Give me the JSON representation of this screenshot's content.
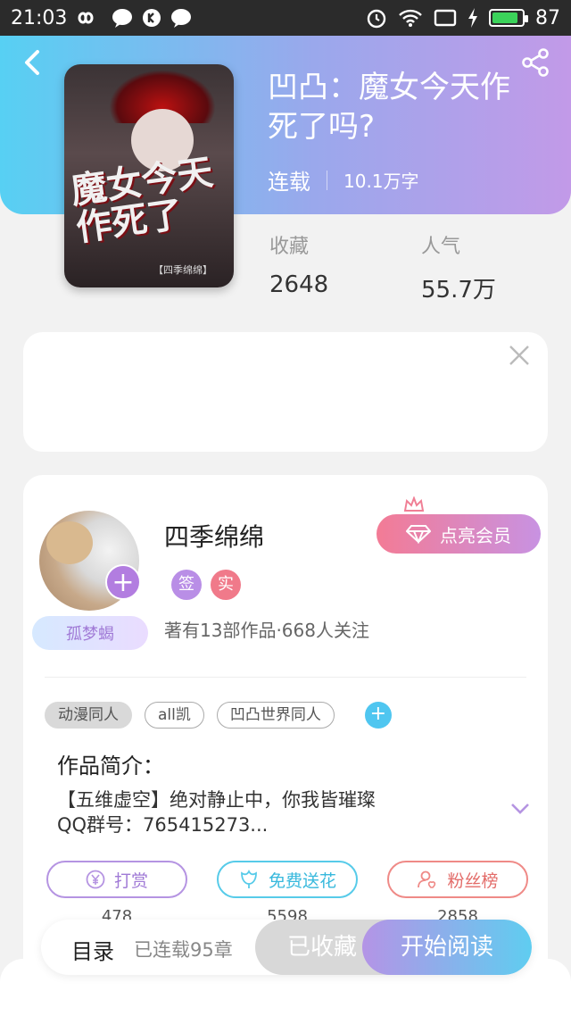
{
  "status_bar": {
    "time": "21:03",
    "battery": "87"
  },
  "book": {
    "title": "凹凸：魔女今天作死了吗?",
    "serial_status": "连载",
    "word_count": "10.1万字",
    "stats": [
      {
        "label": "收藏",
        "value": "2648"
      },
      {
        "label": "人气",
        "value": "55.7万"
      }
    ]
  },
  "author": {
    "name": "四季绵绵",
    "badges": [
      "签",
      "实"
    ],
    "vip_button": "点亮会员",
    "title_pill": "孤梦蝎",
    "stats_text": "著有13部作品·668人关注"
  },
  "tags": [
    "动漫同人",
    "all凯",
    "凹凸世界同人"
  ],
  "intro": {
    "title": "作品简介：",
    "text_line1": "【五维虚空】绝对静止中，你我皆璀璨",
    "text_line2": "QQ群号：765415273..."
  },
  "actions": [
    {
      "label": "打赏",
      "count": "478"
    },
    {
      "label": "免费送花",
      "count": "5598"
    },
    {
      "label": "粉丝榜",
      "count": "2858"
    }
  ],
  "bottom_bar": {
    "toc_label": "目录",
    "chapters": "已连载95章",
    "collected": "已收藏",
    "read": "开始阅读"
  },
  "colors": {
    "hero_start": "#57d0f3",
    "hero_end": "#c29ae8",
    "vip_start": "#f37b95",
    "read_start": "#b494e6"
  }
}
